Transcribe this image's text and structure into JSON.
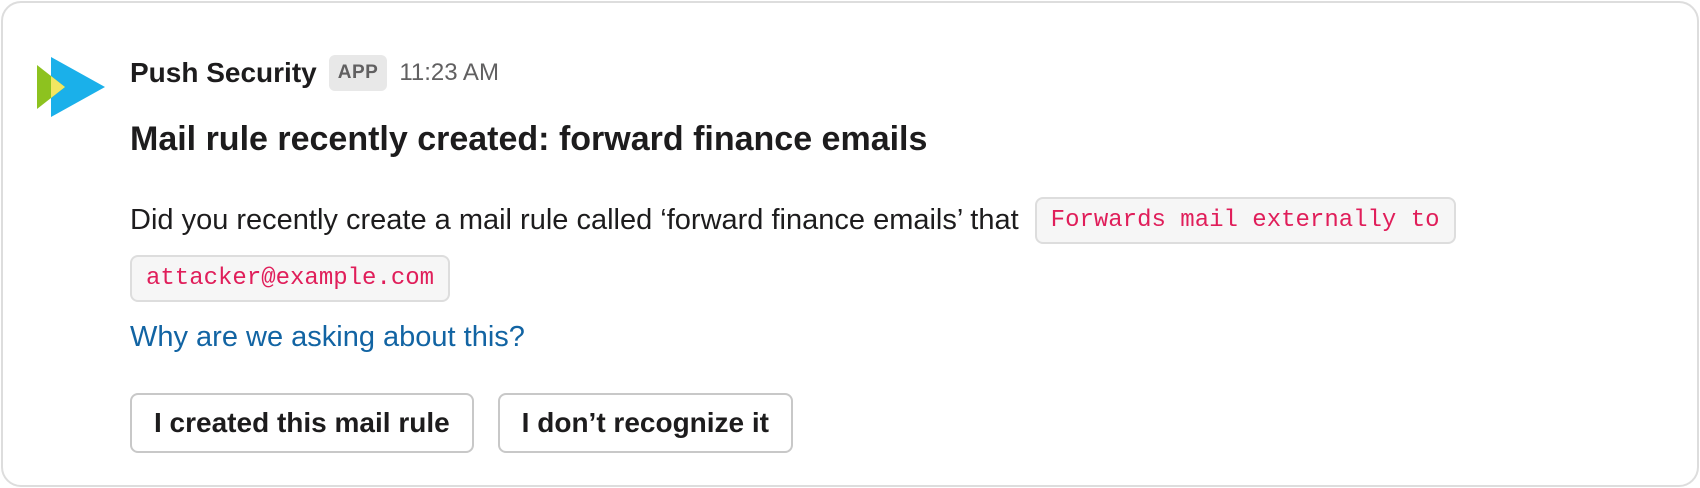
{
  "message": {
    "sender": "Push Security",
    "badge": "APP",
    "timestamp": "11:23 AM",
    "title": "Mail rule recently created: forward finance emails",
    "body_text": "Did you recently create a mail rule called ‘forward finance emails’ that",
    "code_snippets": [
      "Forwards mail externally to",
      "attacker@example.com"
    ],
    "link_text": "Why are we asking about this?",
    "buttons": [
      {
        "label": "I created this mail rule"
      },
      {
        "label": "I don’t recognize it"
      }
    ]
  },
  "colors": {
    "logo_blue": "#1ab0ea",
    "logo_green": "#8dc21f",
    "logo_yellow": "#f2e661",
    "code_text": "#e01e5a",
    "link": "#1264a3"
  },
  "icons": {
    "logo": "push-security-logo-icon"
  }
}
